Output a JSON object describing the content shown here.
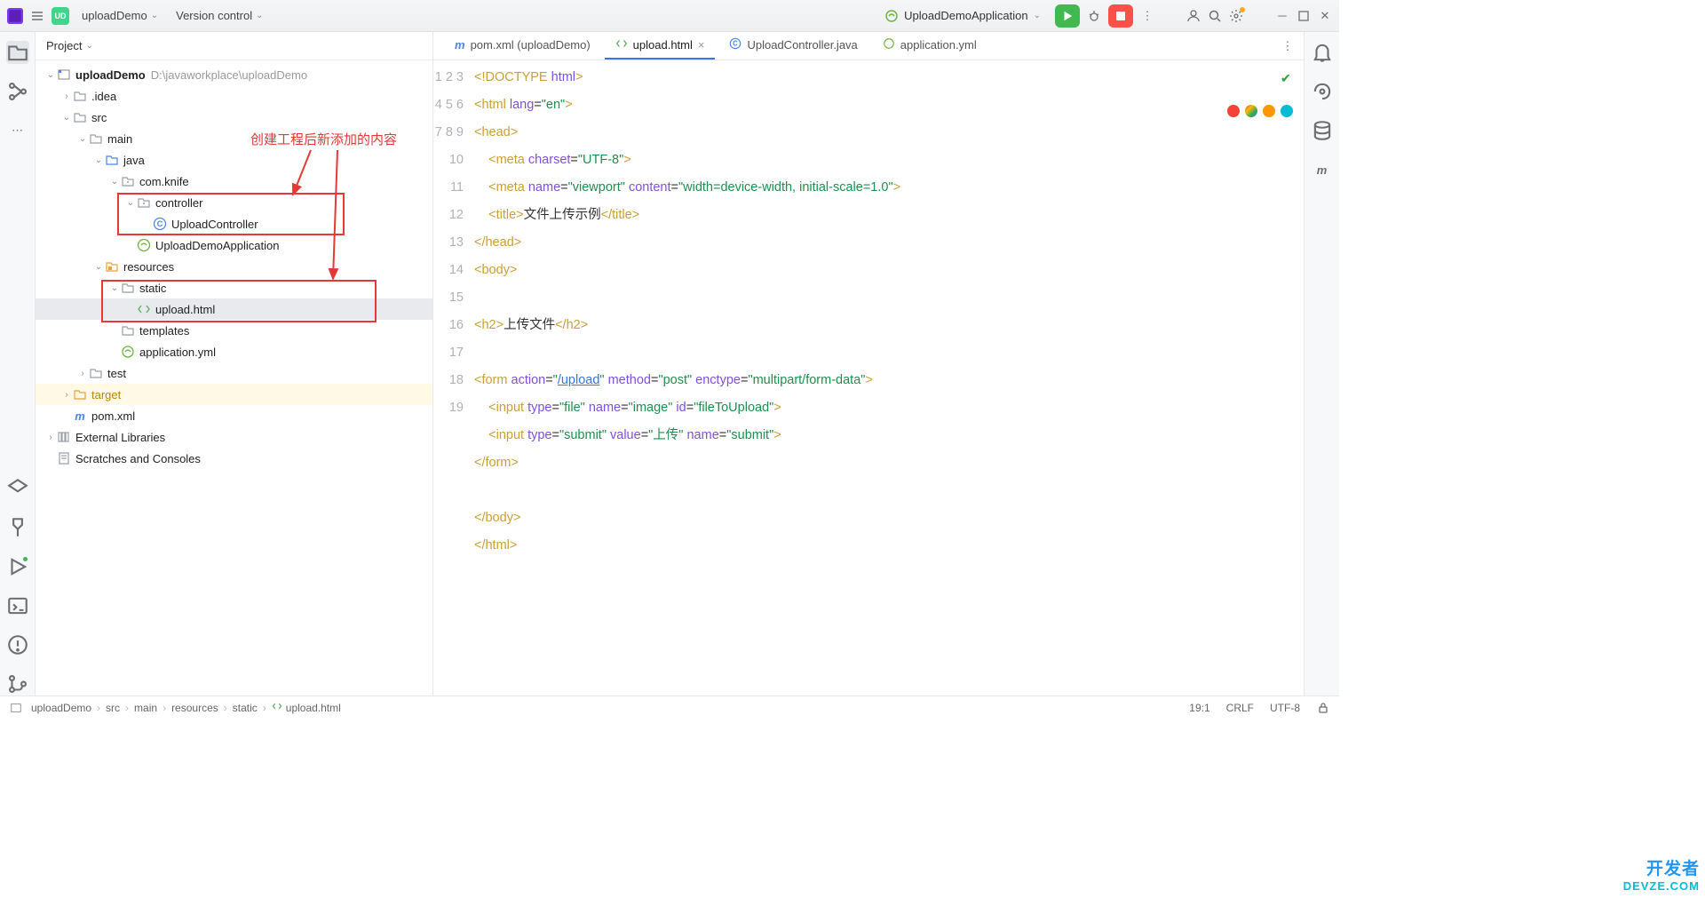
{
  "topbar": {
    "project": "uploadDemo",
    "vcs": "Version control",
    "run_config": "UploadDemoApplication"
  },
  "panel": {
    "title": "Project"
  },
  "tree": {
    "root": {
      "name": "uploadDemo",
      "path": "D:\\javaworkplace\\uploadDemo"
    },
    "idea": ".idea",
    "src": "src",
    "main": "main",
    "java": "java",
    "pkg": "com.knife",
    "controller": "controller",
    "uploadctrl": "UploadController",
    "app": "UploadDemoApplication",
    "resources": "resources",
    "static": "static",
    "uploadhtml": "upload.html",
    "templates": "templates",
    "appyml": "application.yml",
    "test": "test",
    "target": "target",
    "pom": "pom.xml",
    "extlib": "External Libraries",
    "scratch": "Scratches and Consoles"
  },
  "annotation": "创建工程后新添加的内容",
  "tabs": {
    "t0": "pom.xml (uploadDemo)",
    "t1": "upload.html",
    "t2": "UploadController.java",
    "t3": "application.yml"
  },
  "code": {
    "l1_a": "<!DOCTYPE ",
    "l1_b": "html",
    "l1_c": ">",
    "l2_a": "<html ",
    "l2_attr": "lang",
    "l2_eq": "=",
    "l2_val": "\"en\"",
    "l2_c": ">",
    "l3": "<head>",
    "l4_a": "<meta ",
    "l4_attr": "charset",
    "l4_val": "\"UTF-8\"",
    "l4_c": ">",
    "l5_a": "<meta ",
    "l5_a1": "name",
    "l5_v1": "\"viewport\"",
    "l5_a2": "content",
    "l5_v2": "\"width=device-width, initial-scale=1.0\"",
    "l5_c": ">",
    "l6_a": "<title>",
    "l6_txt": "文件上传示例",
    "l6_b": "</title>",
    "l7": "</head>",
    "l8": "<body>",
    "l10_a": "<h2>",
    "l10_txt": "上传文件",
    "l10_b": "</h2>",
    "l12_a": "<form ",
    "l12_a1": "action",
    "l12_v1a": "\"",
    "l12_link": "/upload",
    "l12_v1b": "\"",
    "l12_a2": "method",
    "l12_v2": "\"post\"",
    "l12_a3": "enctype",
    "l12_v3": "\"multipart/form-data\"",
    "l12_c": ">",
    "l13_a": "<input ",
    "l13_a1": "type",
    "l13_v1": "\"file\"",
    "l13_a2": "name",
    "l13_v2": "\"image\"",
    "l13_a3": "id",
    "l13_v3": "\"fileToUpload\"",
    "l13_c": ">",
    "l14_a": "<input ",
    "l14_a1": "type",
    "l14_v1": "\"submit\"",
    "l14_a2": "value",
    "l14_v2": "\"上传\"",
    "l14_a3": "name",
    "l14_v3": "\"submit\"",
    "l14_c": ">",
    "l15": "</form>",
    "l17": "</body>",
    "l18": "</html>"
  },
  "breadcrumb": {
    "b0": "uploadDemo",
    "b1": "src",
    "b2": "main",
    "b3": "resources",
    "b4": "static",
    "b5": "upload.html"
  },
  "status": {
    "pos": "19:1",
    "le": "CRLF",
    "enc": "UTF-8"
  },
  "watermark": {
    "l1": "开发者",
    "l2": "DEVZE.COM"
  }
}
